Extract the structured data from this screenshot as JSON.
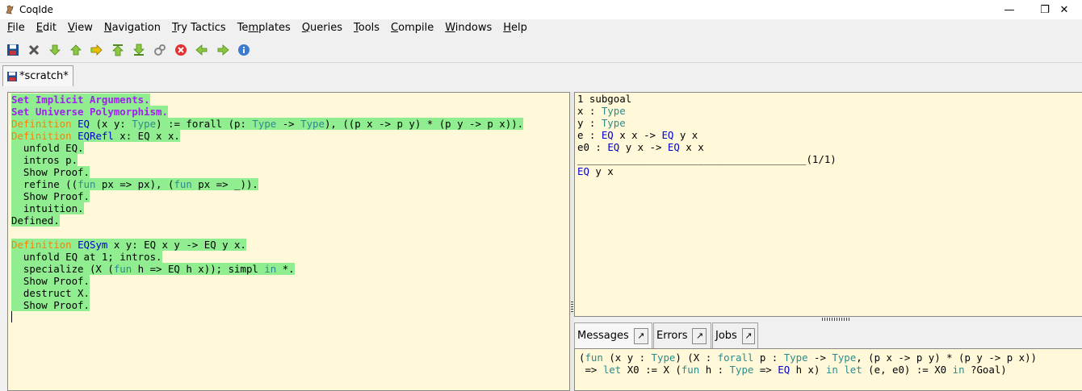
{
  "window": {
    "title": "CoqIde",
    "controls": {
      "minimize": "—",
      "restore": "❐",
      "close": "✕"
    }
  },
  "menu": [
    "File",
    "Edit",
    "View",
    "Navigation",
    "Try Tactics",
    "Templates",
    "Queries",
    "Tools",
    "Compile",
    "Windows",
    "Help"
  ],
  "menu_mnemonics": [
    "F",
    "E",
    "V",
    "N",
    "T",
    "m",
    "Q",
    "T",
    "C",
    "W",
    "H"
  ],
  "toolbar_icons": [
    "save-icon",
    "close-icon",
    "forward-one-icon",
    "backward-one-icon",
    "go-to-cursor-icon",
    "restart-icon",
    "go-to-end-icon",
    "compute-icon",
    "interrupt-icon",
    "previous-icon",
    "next-icon",
    "about-icon"
  ],
  "tab": {
    "label": "*scratch*"
  },
  "script": {
    "lines": [
      [
        {
          "t": "Set Implicit Arguments.",
          "c": "vern"
        }
      ],
      [
        {
          "t": "Set Universe Polymorphism.",
          "c": "vern"
        }
      ],
      [
        {
          "t": "Definition",
          "c": "kw"
        },
        {
          "t": " EQ ",
          "c": "nm"
        },
        {
          "t": "(x y: ",
          "c": "tac"
        },
        {
          "t": "Type",
          "c": "ty"
        },
        {
          "t": ") := forall (p: ",
          "c": "tac"
        },
        {
          "t": "Type",
          "c": "ty"
        },
        {
          "t": " -> ",
          "c": "tac"
        },
        {
          "t": "Type",
          "c": "ty"
        },
        {
          "t": "), ((p x -> p y) * (p y -> p x)).",
          "c": "tac"
        }
      ],
      [
        {
          "t": "Definition",
          "c": "kw"
        },
        {
          "t": " EQRefl",
          "c": "nm"
        },
        {
          "t": " x: EQ x x.",
          "c": "tac"
        }
      ],
      [
        {
          "t": "  unfold EQ.",
          "c": "tac"
        }
      ],
      [
        {
          "t": "  intros p.",
          "c": "tac"
        }
      ],
      [
        {
          "t": "  Show Proof.",
          "c": "tac"
        }
      ],
      [
        {
          "t": "  refine ((",
          "c": "tac"
        },
        {
          "t": "fun",
          "c": "ty"
        },
        {
          "t": " px => px), (",
          "c": "tac"
        },
        {
          "t": "fun",
          "c": "ty"
        },
        {
          "t": " px => _)).",
          "c": "tac"
        }
      ],
      [
        {
          "t": "  Show Proof.",
          "c": "tac"
        }
      ],
      [
        {
          "t": "  intuition.",
          "c": "tac"
        }
      ],
      [
        {
          "t": "Defined.",
          "c": "tac"
        }
      ],
      [],
      [
        {
          "t": "Definition",
          "c": "kw"
        },
        {
          "t": " EQSym",
          "c": "nm"
        },
        {
          "t": " x y: EQ x y -> EQ y x.",
          "c": "tac"
        }
      ],
      [
        {
          "t": "  unfold EQ at 1; intros.",
          "c": "tac"
        }
      ],
      [
        {
          "t": "  specialize (X (",
          "c": "tac"
        },
        {
          "t": "fun",
          "c": "ty"
        },
        {
          "t": " h => EQ h x)); simpl ",
          "c": "tac"
        },
        {
          "t": "in",
          "c": "ty"
        },
        {
          "t": " *.",
          "c": "tac"
        }
      ],
      [
        {
          "t": "  Show Proof.",
          "c": "tac"
        }
      ],
      [
        {
          "t": "  destruct X.",
          "c": "tac"
        }
      ],
      [
        {
          "t": "  Show Proof.",
          "c": "tac"
        }
      ]
    ],
    "highlighted_line_count": 18
  },
  "goals": {
    "lines": [
      [
        {
          "t": "1 subgoal",
          "c": "tac"
        }
      ],
      [
        {
          "t": "x : ",
          "c": "tac"
        },
        {
          "t": "Type",
          "c": "ty"
        }
      ],
      [
        {
          "t": "y : ",
          "c": "tac"
        },
        {
          "t": "Type",
          "c": "ty"
        }
      ],
      [
        {
          "t": "e : ",
          "c": "tac"
        },
        {
          "t": "EQ",
          "c": "nm"
        },
        {
          "t": " x x -> ",
          "c": "tac"
        },
        {
          "t": "EQ",
          "c": "nm"
        },
        {
          "t": " y x",
          "c": "tac"
        }
      ],
      [
        {
          "t": "e0 : ",
          "c": "tac"
        },
        {
          "t": "EQ",
          "c": "nm"
        },
        {
          "t": " y x -> ",
          "c": "tac"
        },
        {
          "t": "EQ",
          "c": "nm"
        },
        {
          "t": " x x",
          "c": "tac"
        }
      ],
      [
        {
          "t": "______________________________________(1/1)",
          "c": "tac"
        }
      ],
      [
        {
          "t": "EQ",
          "c": "nm"
        },
        {
          "t": " y x",
          "c": "tac"
        }
      ]
    ]
  },
  "message_tabs": [
    {
      "label": "Messages",
      "detach": "↗"
    },
    {
      "label": "Errors",
      "detach": "↗"
    },
    {
      "label": "Jobs",
      "detach": "↗"
    }
  ],
  "messages": {
    "lines": [
      [
        {
          "t": "(",
          "c": "tac"
        },
        {
          "t": "fun",
          "c": "ty"
        },
        {
          "t": " (x y : ",
          "c": "tac"
        },
        {
          "t": "Type",
          "c": "ty"
        },
        {
          "t": ") (X : ",
          "c": "tac"
        },
        {
          "t": "forall",
          "c": "ty"
        },
        {
          "t": " p : ",
          "c": "tac"
        },
        {
          "t": "Type",
          "c": "ty"
        },
        {
          "t": " -> ",
          "c": "tac"
        },
        {
          "t": "Type",
          "c": "ty"
        },
        {
          "t": ", (p x -> p y) * (p y -> p x))",
          "c": "tac"
        }
      ],
      [
        {
          "t": " => ",
          "c": "tac"
        },
        {
          "t": "let",
          "c": "ty"
        },
        {
          "t": " X0 := X (",
          "c": "tac"
        },
        {
          "t": "fun",
          "c": "ty"
        },
        {
          "t": " h : ",
          "c": "tac"
        },
        {
          "t": "Type",
          "c": "ty"
        },
        {
          "t": " => ",
          "c": "tac"
        },
        {
          "t": "EQ",
          "c": "nm"
        },
        {
          "t": " h x) ",
          "c": "tac"
        },
        {
          "t": "in",
          "c": "ty"
        },
        {
          "t": " ",
          "c": "tac"
        },
        {
          "t": "let",
          "c": "ty"
        },
        {
          "t": " (e, e0) := X0 ",
          "c": "tac"
        },
        {
          "t": "in",
          "c": "ty"
        },
        {
          "t": " ?Goal)",
          "c": "tac"
        }
      ]
    ]
  },
  "colors": {
    "editor_bg": "#fff9d9",
    "processed_bg": "#90ee90",
    "keyword": "#ff7f00",
    "vernacular": "#a020f0",
    "type": "#2e8b8b",
    "name": "#0000cd"
  }
}
